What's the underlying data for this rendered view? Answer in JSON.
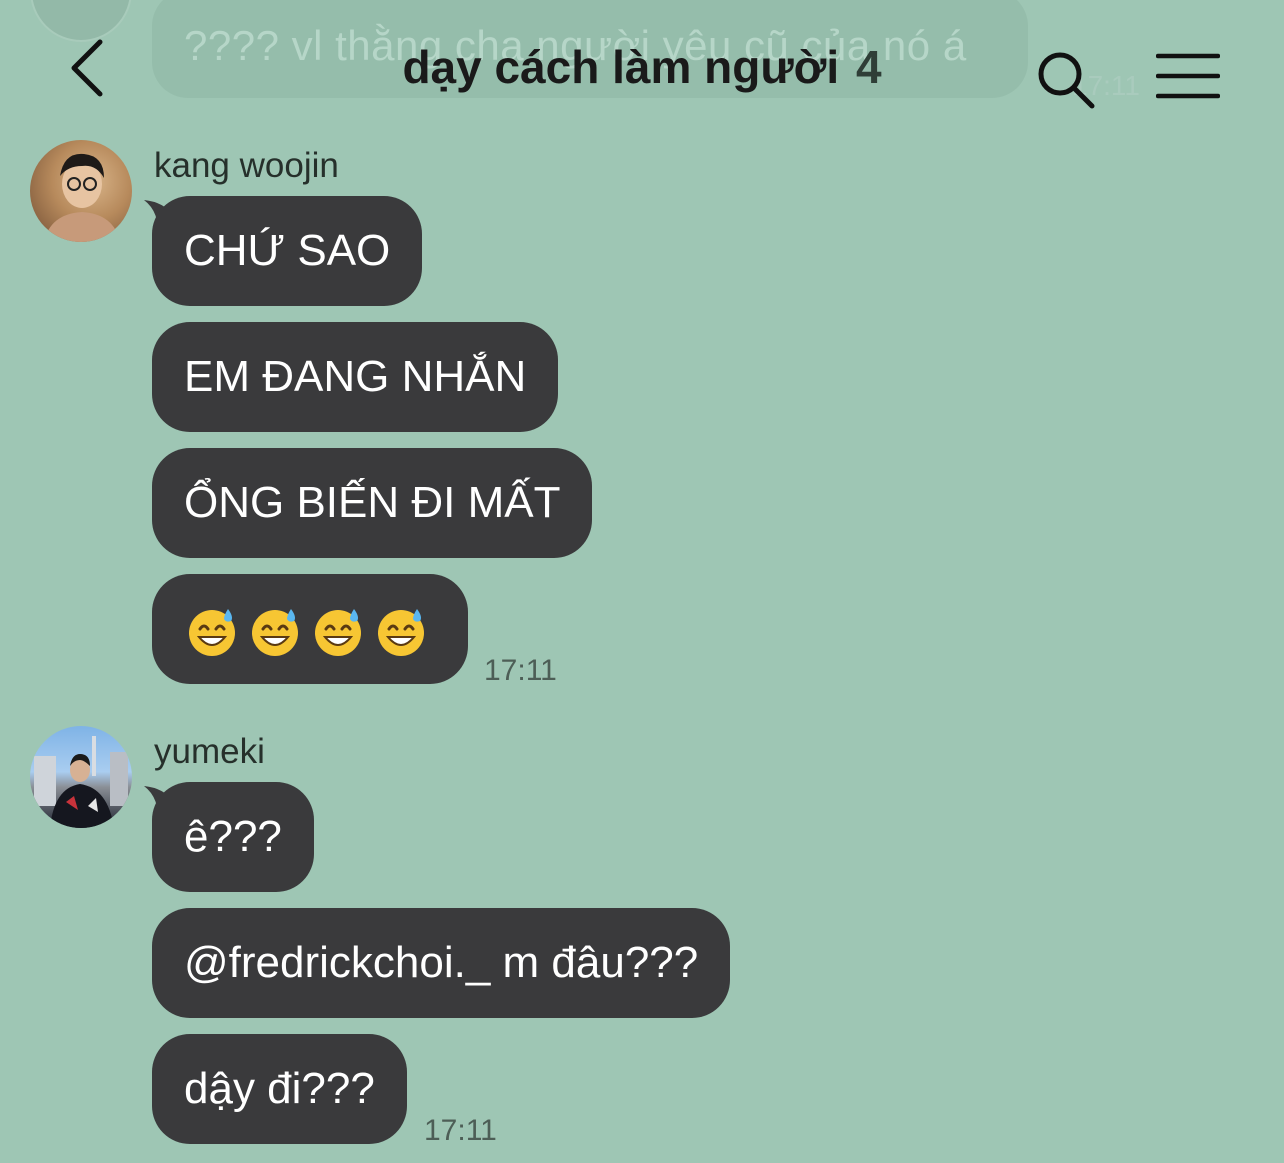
{
  "previous_message": {
    "text": "???? vl thằng cha người yêu cũ của nó á",
    "time": "17:11"
  },
  "header": {
    "title": "dạy cách làm người",
    "member_count": "4",
    "icons": [
      "chevron-left-icon",
      "search-icon",
      "menu-icon"
    ]
  },
  "groups": [
    {
      "sender": "kang woojin",
      "messages": [
        "CHỨ SAO",
        "EM ĐANG NHẮN",
        "ỔNG BIẾN ĐI MẤT",
        "😅😅😅😅"
      ],
      "time": "17:11"
    },
    {
      "sender": "yumeki",
      "messages": [
        "ê???",
        "@fredrickchoi._ m đâu???",
        "dậy đi???"
      ],
      "time": "17:11"
    }
  ],
  "colors": {
    "background": "#9ec6b4",
    "bubble": "#3a3a3c",
    "bubble_text": "#ffffff"
  }
}
